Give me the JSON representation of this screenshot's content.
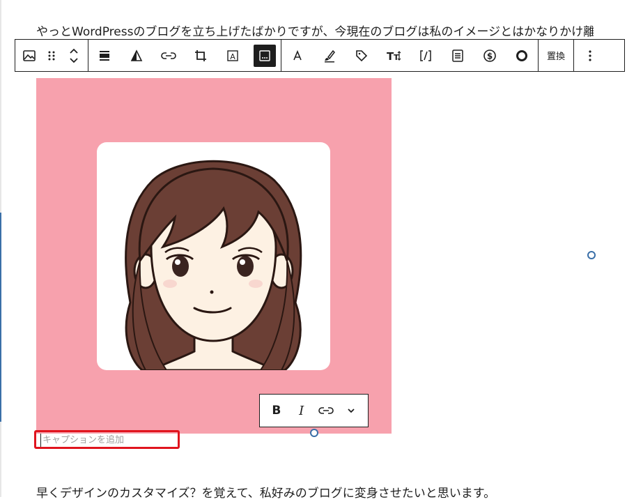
{
  "content": {
    "paragraph_top": "やっとWordPressのブログを立ち上げたばかりですが、今現在のブログは私のイメージとはかなりかけ離れています。",
    "paragraph_bottom": "早くデザインのカスタマイズ？を覚えて、私好みのブログに変身させたいと思います。"
  },
  "block_toolbar": {
    "block_type_icon": "image-icon",
    "drag_icon": "drag-handle-icon",
    "move_up_icon": "chevron-up-icon",
    "move_down_icon": "chevron-down-icon",
    "tools": [
      {
        "icon": "align-icon"
      },
      {
        "icon": "duotone-icon"
      },
      {
        "icon": "link-icon"
      },
      {
        "icon": "crop-icon"
      },
      {
        "icon": "text-over-image-icon"
      },
      {
        "icon": "caption-icon",
        "active": true
      },
      {
        "icon": "font-icon"
      },
      {
        "icon": "brush-icon"
      },
      {
        "icon": "tag-icon"
      },
      {
        "icon": "text-size-icon"
      },
      {
        "icon": "code-icon"
      },
      {
        "icon": "list-icon"
      },
      {
        "icon": "dollar-icon"
      },
      {
        "icon": "circle-icon"
      }
    ],
    "replace_label": "置換",
    "more_icon": "more-vertical-icon"
  },
  "image": {
    "background_color": "#f7a1ad",
    "alt": "illustrated woman avatar"
  },
  "format_toolbar": {
    "bold_label": "B",
    "italic_label": "I",
    "link_icon": "link-icon",
    "more_icon": "chevron-down-icon"
  },
  "caption": {
    "placeholder": "キャプションを追加",
    "value": "",
    "highlight_color": "#e0141e"
  }
}
